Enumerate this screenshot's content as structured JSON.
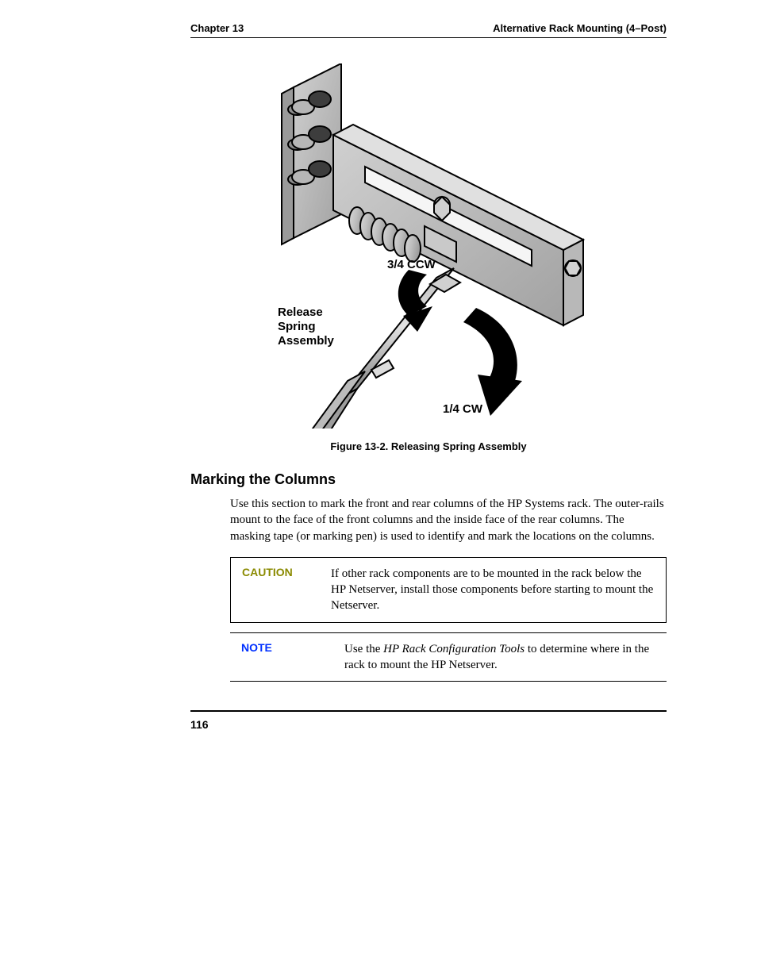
{
  "header": {
    "left": "Chapter 13",
    "right": "Alternative Rack Mounting (4–Post)"
  },
  "figure": {
    "caption": "Figure 13-2. Releasing Spring Assembly",
    "labels": {
      "ccw": "3/4 CCW",
      "release": "Release\nSpring\nAssembly",
      "cw": "1/4 CW"
    }
  },
  "section": {
    "heading": "Marking the Columns",
    "paragraph": "Use this section to mark the front and rear columns of the HP Systems rack. The outer-rails mount to the face of the front columns and the inside face of the rear columns. The masking tape (or marking pen) is used to identify and mark the locations on the columns."
  },
  "caution": {
    "label": "CAUTION",
    "text": "If other rack components are to be mounted in the rack below the HP Netserver, install those components before starting to mount the Netserver."
  },
  "note": {
    "label": "NOTE",
    "prefix": "Use the ",
    "italic": "HP Rack Configuration Tools",
    "suffix": " to determine where in the rack to mount the HP Netserver."
  },
  "footer": {
    "page_number": "116"
  }
}
